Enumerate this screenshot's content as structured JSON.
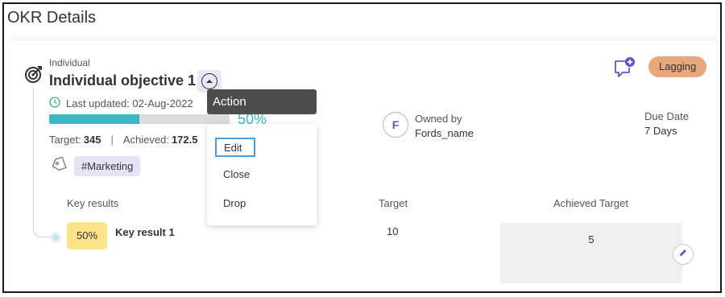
{
  "page": {
    "title": "OKR Details"
  },
  "objective": {
    "type": "Individual",
    "title": "Individual objective 1",
    "last_updated": "Last updated: 02-Aug-2022",
    "progress_percent": 50,
    "progress_text": "50%",
    "target_label": "Target:",
    "target_value": "345",
    "achieved_label": "Achieved:",
    "achieved_value": "172.5",
    "separator": "|",
    "tag": "#Marketing",
    "status": "Lagging",
    "owner_label": "Owned by",
    "owner_name": "Fords_name",
    "owner_initial": "F",
    "due_label": "Due Date",
    "due_value": "7 Days"
  },
  "key_results": {
    "headers": {
      "name": "Key results",
      "target": "Target",
      "achieved": "Achieved Target"
    },
    "rows": [
      {
        "percent": "50%",
        "name": "Key result 1",
        "target": "10",
        "achieved": "5"
      }
    ]
  },
  "action_menu": {
    "tooltip": "Action",
    "items": [
      "Edit",
      "Close",
      "Drop"
    ]
  },
  "colors": {
    "progress_fill": "#3cb8c3",
    "status_badge": "#e8a77c",
    "tag_bg": "#e6e3f7",
    "kr_percent_bg": "#fbe38a",
    "accent": "#5a54c8"
  },
  "icons": {
    "objective": "target-icon",
    "toggle": "chevron-up-icon",
    "clock": "clock-icon",
    "tag": "tag-icon",
    "comment": "comment-add-icon",
    "edit": "pencil-icon"
  }
}
